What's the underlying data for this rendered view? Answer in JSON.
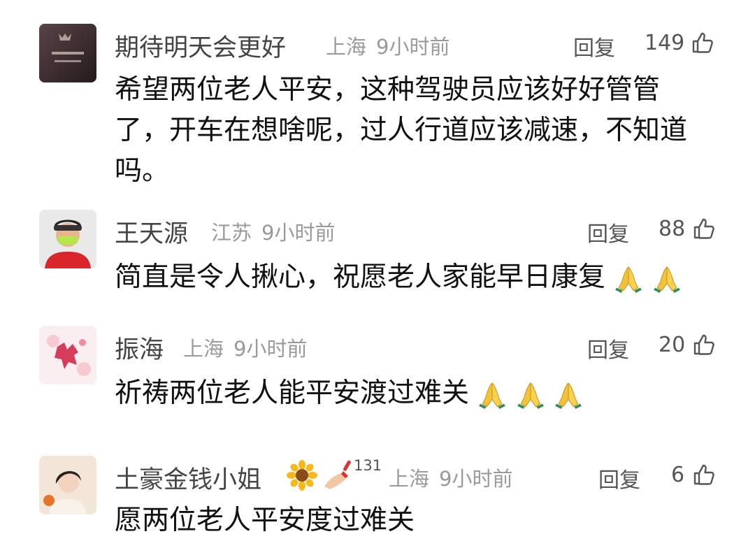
{
  "comments": [
    {
      "author": "期待明天会更好",
      "location": "上海",
      "time": "9小时前",
      "reply_label": "回复",
      "likes": "149",
      "text_lines": [
        "希望两位老人平安，这种驾驶员应该好好管管",
        "了，开车在想啥呢，过人行道应该减速，不知道",
        "吗。"
      ]
    },
    {
      "author": "王天源",
      "location": "江苏",
      "time": "9小时前",
      "reply_label": "回复",
      "likes": "88",
      "text": "简直是令人揪心，祝愿老人家能早日康复"
    },
    {
      "author": "振海",
      "location": "上海",
      "time": "9小时前",
      "reply_label": "回复",
      "likes": "20",
      "text": "祈祷两位老人能平安渡过难关"
    },
    {
      "author": "土豪金钱小姐",
      "badge_count": "131",
      "location": "上海",
      "time": "9小时前",
      "reply_label": "回复",
      "likes": "6",
      "text": "愿两位老人平安度过难关"
    }
  ],
  "icons": {
    "thumb": "thumbs-up-outline",
    "prayer": "folded-hands-emoji",
    "flower": "sunflower-emoji",
    "nail": "nail-polish-emoji"
  },
  "colors": {
    "name": "#444444",
    "meta": "#9a9a9a",
    "text": "#111111"
  }
}
